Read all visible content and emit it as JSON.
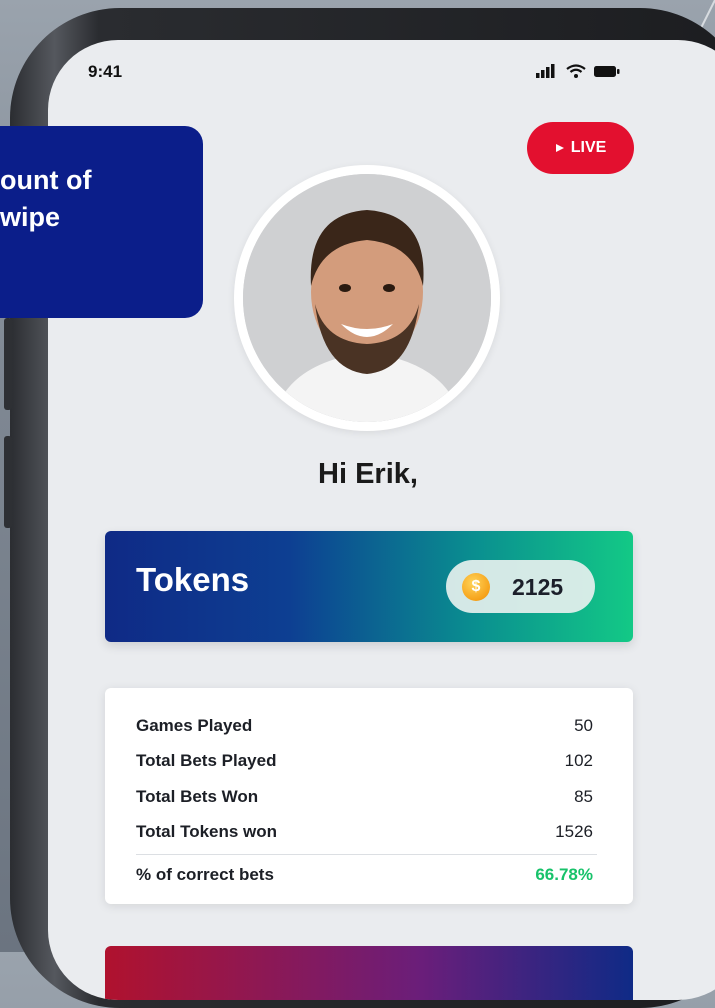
{
  "status_bar": {
    "time": "9:41",
    "icons": [
      "signal-icon",
      "wifi-icon",
      "battery-icon"
    ]
  },
  "live_badge": {
    "icon": "play-icon",
    "label": "LIVE",
    "color": "#e3102f"
  },
  "profile": {
    "greeting": "Hi Erik,"
  },
  "tokens": {
    "label": "Tokens",
    "icon": "coin-icon",
    "coin_symbol": "$",
    "value": "2125"
  },
  "stats": {
    "rows": [
      {
        "label": "Games Played",
        "value": "50"
      },
      {
        "label": "Total Bets Played",
        "value": "102"
      },
      {
        "label": "Total Bets Won",
        "value": "85"
      },
      {
        "label": "Total Tokens won",
        "value": "1526"
      },
      {
        "label": "% of correct bets",
        "value": "66.78%"
      }
    ],
    "highlight_color": "#17c26a"
  },
  "callout": {
    "lines": "ount of\nwipe",
    "color": "#0b1e8a"
  }
}
